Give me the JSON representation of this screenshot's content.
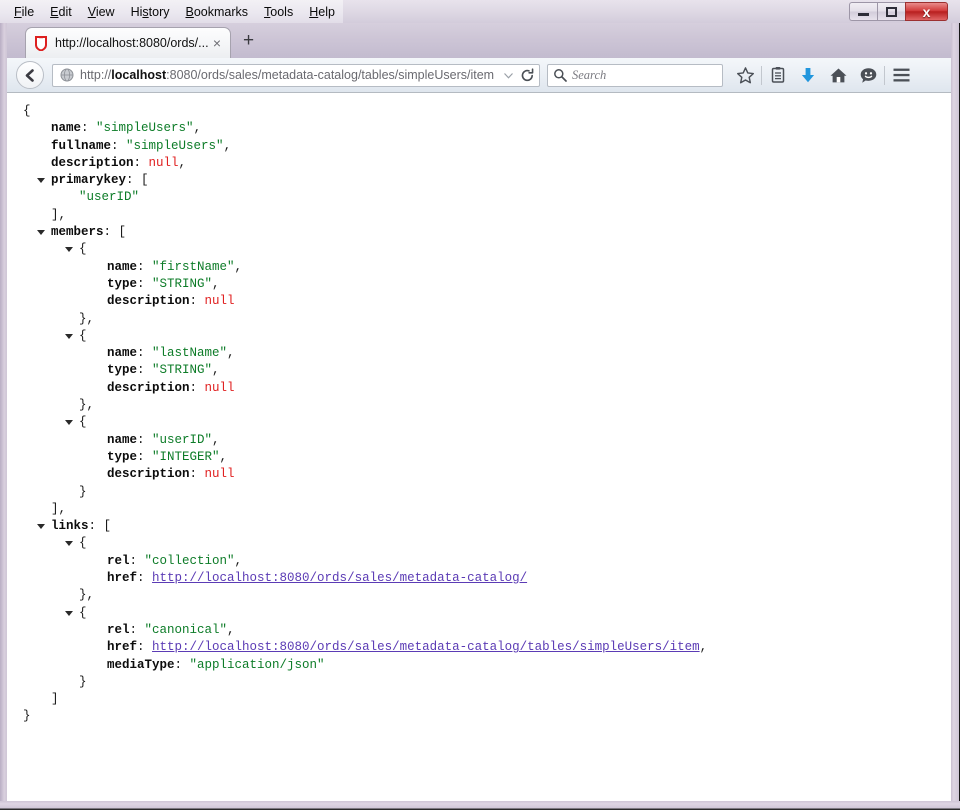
{
  "window": {
    "menu": [
      {
        "pre": "",
        "accel": "F",
        "post": "ile"
      },
      {
        "pre": "",
        "accel": "E",
        "post": "dit"
      },
      {
        "pre": "",
        "accel": "V",
        "post": "iew"
      },
      {
        "pre": "Hi",
        "accel": "s",
        "post": "tory"
      },
      {
        "pre": "",
        "accel": "B",
        "post": "ookmarks"
      },
      {
        "pre": "",
        "accel": "T",
        "post": "ools"
      },
      {
        "pre": "",
        "accel": "H",
        "post": "elp"
      }
    ],
    "controls": {
      "minimize_label": "Minimize",
      "maximize_label": "Maximize",
      "close_label": "x"
    }
  },
  "tabs": {
    "active": {
      "title": "http://localhost:8080/ords/...",
      "close_label": "×",
      "favicon_name": "firefox-shield-favicon"
    },
    "new_tab_label": "+"
  },
  "toolbar": {
    "back_label": "←",
    "url": {
      "scheme": "http://",
      "host_bold": "localhost",
      "rest": ":8080/ords/sales/metadata-catalog/tables/simpleUsers/item",
      "full": "http://localhost:8080/ords/sales/metadata-catalog/tables/simpleUsers/item"
    },
    "search_placeholder": "Search",
    "icons": [
      "bookmark-star-icon",
      "reader-list-icon",
      "downloads-icon",
      "home-icon",
      "sync-smiley-icon",
      "hamburger-menu-icon"
    ],
    "accent_download": "#2196dd"
  },
  "json_document": {
    "rows": [
      {
        "indent": 0,
        "twisty": false,
        "parts": [
          {
            "t": "punct",
            "v": "{"
          }
        ]
      },
      {
        "indent": 1,
        "twisty": false,
        "parts": [
          {
            "t": "key",
            "v": "name"
          },
          {
            "t": "punct",
            "v": ": "
          },
          {
            "t": "str",
            "v": "\"simpleUsers\""
          },
          {
            "t": "punct",
            "v": ","
          }
        ]
      },
      {
        "indent": 1,
        "twisty": false,
        "parts": [
          {
            "t": "key",
            "v": "fullname"
          },
          {
            "t": "punct",
            "v": ": "
          },
          {
            "t": "str",
            "v": "\"simpleUsers\""
          },
          {
            "t": "punct",
            "v": ","
          }
        ]
      },
      {
        "indent": 1,
        "twisty": false,
        "parts": [
          {
            "t": "key",
            "v": "description"
          },
          {
            "t": "punct",
            "v": ": "
          },
          {
            "t": "null",
            "v": "null"
          },
          {
            "t": "punct",
            "v": ","
          }
        ]
      },
      {
        "indent": 1,
        "twisty": true,
        "parts": [
          {
            "t": "key",
            "v": "primarykey"
          },
          {
            "t": "punct",
            "v": ": ["
          }
        ]
      },
      {
        "indent": 2,
        "twisty": false,
        "parts": [
          {
            "t": "str",
            "v": "\"userID\""
          }
        ]
      },
      {
        "indent": 1,
        "twisty": false,
        "parts": [
          {
            "t": "punct",
            "v": "],"
          }
        ]
      },
      {
        "indent": 1,
        "twisty": true,
        "parts": [
          {
            "t": "key",
            "v": "members"
          },
          {
            "t": "punct",
            "v": ": ["
          }
        ]
      },
      {
        "indent": 2,
        "twisty": true,
        "parts": [
          {
            "t": "punct",
            "v": "{"
          }
        ]
      },
      {
        "indent": 3,
        "twisty": false,
        "parts": [
          {
            "t": "key",
            "v": "name"
          },
          {
            "t": "punct",
            "v": ": "
          },
          {
            "t": "str",
            "v": "\"firstName\""
          },
          {
            "t": "punct",
            "v": ","
          }
        ]
      },
      {
        "indent": 3,
        "twisty": false,
        "parts": [
          {
            "t": "key",
            "v": "type"
          },
          {
            "t": "punct",
            "v": ": "
          },
          {
            "t": "str",
            "v": "\"STRING\""
          },
          {
            "t": "punct",
            "v": ","
          }
        ]
      },
      {
        "indent": 3,
        "twisty": false,
        "parts": [
          {
            "t": "key",
            "v": "description"
          },
          {
            "t": "punct",
            "v": ": "
          },
          {
            "t": "null",
            "v": "null"
          }
        ]
      },
      {
        "indent": 2,
        "twisty": false,
        "parts": [
          {
            "t": "punct",
            "v": "},"
          }
        ]
      },
      {
        "indent": 2,
        "twisty": true,
        "parts": [
          {
            "t": "punct",
            "v": "{"
          }
        ]
      },
      {
        "indent": 3,
        "twisty": false,
        "parts": [
          {
            "t": "key",
            "v": "name"
          },
          {
            "t": "punct",
            "v": ": "
          },
          {
            "t": "str",
            "v": "\"lastName\""
          },
          {
            "t": "punct",
            "v": ","
          }
        ]
      },
      {
        "indent": 3,
        "twisty": false,
        "parts": [
          {
            "t": "key",
            "v": "type"
          },
          {
            "t": "punct",
            "v": ": "
          },
          {
            "t": "str",
            "v": "\"STRING\""
          },
          {
            "t": "punct",
            "v": ","
          }
        ]
      },
      {
        "indent": 3,
        "twisty": false,
        "parts": [
          {
            "t": "key",
            "v": "description"
          },
          {
            "t": "punct",
            "v": ": "
          },
          {
            "t": "null",
            "v": "null"
          }
        ]
      },
      {
        "indent": 2,
        "twisty": false,
        "parts": [
          {
            "t": "punct",
            "v": "},"
          }
        ]
      },
      {
        "indent": 2,
        "twisty": true,
        "parts": [
          {
            "t": "punct",
            "v": "{"
          }
        ]
      },
      {
        "indent": 3,
        "twisty": false,
        "parts": [
          {
            "t": "key",
            "v": "name"
          },
          {
            "t": "punct",
            "v": ": "
          },
          {
            "t": "str",
            "v": "\"userID\""
          },
          {
            "t": "punct",
            "v": ","
          }
        ]
      },
      {
        "indent": 3,
        "twisty": false,
        "parts": [
          {
            "t": "key",
            "v": "type"
          },
          {
            "t": "punct",
            "v": ": "
          },
          {
            "t": "str",
            "v": "\"INTEGER\""
          },
          {
            "t": "punct",
            "v": ","
          }
        ]
      },
      {
        "indent": 3,
        "twisty": false,
        "parts": [
          {
            "t": "key",
            "v": "description"
          },
          {
            "t": "punct",
            "v": ": "
          },
          {
            "t": "null",
            "v": "null"
          }
        ]
      },
      {
        "indent": 2,
        "twisty": false,
        "parts": [
          {
            "t": "punct",
            "v": "}"
          }
        ]
      },
      {
        "indent": 1,
        "twisty": false,
        "parts": [
          {
            "t": "punct",
            "v": "],"
          }
        ]
      },
      {
        "indent": 1,
        "twisty": true,
        "parts": [
          {
            "t": "key",
            "v": "links"
          },
          {
            "t": "punct",
            "v": ": ["
          }
        ]
      },
      {
        "indent": 2,
        "twisty": true,
        "parts": [
          {
            "t": "punct",
            "v": "{"
          }
        ]
      },
      {
        "indent": 3,
        "twisty": false,
        "parts": [
          {
            "t": "key",
            "v": "rel"
          },
          {
            "t": "punct",
            "v": ": "
          },
          {
            "t": "str",
            "v": "\"collection\""
          },
          {
            "t": "punct",
            "v": ","
          }
        ]
      },
      {
        "indent": 3,
        "twisty": false,
        "parts": [
          {
            "t": "key",
            "v": "href"
          },
          {
            "t": "punct",
            "v": ": "
          },
          {
            "t": "url",
            "v": "http://localhost:8080/ords/sales/metadata-catalog/"
          }
        ]
      },
      {
        "indent": 2,
        "twisty": false,
        "parts": [
          {
            "t": "punct",
            "v": "},"
          }
        ]
      },
      {
        "indent": 2,
        "twisty": true,
        "parts": [
          {
            "t": "punct",
            "v": "{"
          }
        ]
      },
      {
        "indent": 3,
        "twisty": false,
        "parts": [
          {
            "t": "key",
            "v": "rel"
          },
          {
            "t": "punct",
            "v": ": "
          },
          {
            "t": "str",
            "v": "\"canonical\""
          },
          {
            "t": "punct",
            "v": ","
          }
        ]
      },
      {
        "indent": 3,
        "twisty": false,
        "parts": [
          {
            "t": "key",
            "v": "href"
          },
          {
            "t": "punct",
            "v": ": "
          },
          {
            "t": "url",
            "v": "http://localhost:8080/ords/sales/metadata-catalog/tables/simpleUsers/item"
          },
          {
            "t": "punct",
            "v": ","
          }
        ]
      },
      {
        "indent": 3,
        "twisty": false,
        "parts": [
          {
            "t": "key",
            "v": "mediaType"
          },
          {
            "t": "punct",
            "v": ": "
          },
          {
            "t": "str",
            "v": "\"application/json\""
          }
        ]
      },
      {
        "indent": 2,
        "twisty": false,
        "parts": [
          {
            "t": "punct",
            "v": "}"
          }
        ]
      },
      {
        "indent": 1,
        "twisty": false,
        "parts": [
          {
            "t": "punct",
            "v": "]"
          }
        ]
      },
      {
        "indent": 0,
        "twisty": false,
        "parts": [
          {
            "t": "punct",
            "v": "}"
          }
        ]
      }
    ]
  },
  "colors": {
    "string_green": "#0d7c28",
    "null_red": "#e02020",
    "link_purple": "#5b3bb5",
    "key_black": "#0c0c0c",
    "frame_lavender": "#cfc6d6"
  }
}
